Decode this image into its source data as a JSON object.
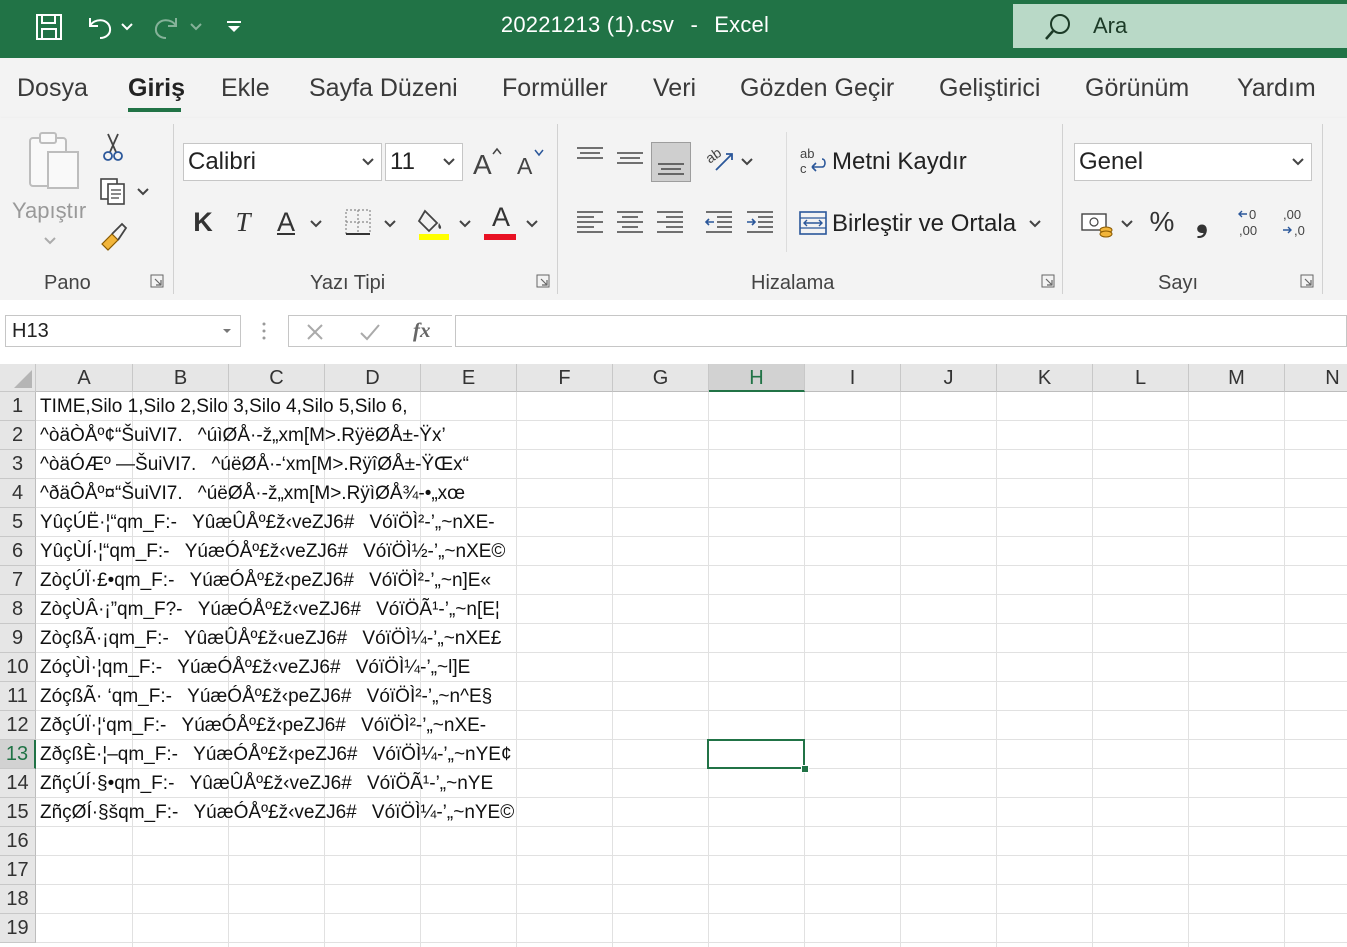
{
  "window": {
    "file_name": "20221213 (1).csv",
    "separator": "-",
    "app_name": "Excel",
    "search_placeholder": "Ara"
  },
  "tabs": [
    "Dosya",
    "Giriş",
    "Ekle",
    "Sayfa Düzeni",
    "Formüller",
    "Veri",
    "Gözden Geçir",
    "Geliştirici",
    "Görünüm",
    "Yardım"
  ],
  "active_tab": "Giriş",
  "ribbon": {
    "clipboard": {
      "paste_label": "Yapıştır",
      "group_label": "Pano"
    },
    "font": {
      "font_name": "Calibri",
      "font_size": "11",
      "bold": "K",
      "italic": "T",
      "underline": "A",
      "font_color_glyph": "A",
      "group_label": "Yazı Tipi",
      "highlight_color": "#ffff00",
      "font_color": "#ff0000"
    },
    "alignment": {
      "wrap_text": "Metni Kaydır",
      "merge_center": "Birleştir ve Ortala",
      "group_label": "Hizalama"
    },
    "number": {
      "format": "Genel",
      "percent": "%",
      "comma": "❟",
      "group_label": "Sayı"
    }
  },
  "formula_bar": {
    "name_box": "H13",
    "formula": ""
  },
  "columns": [
    "A",
    "B",
    "C",
    "D",
    "E",
    "F",
    "G",
    "H",
    "I",
    "J",
    "K",
    "L",
    "M",
    "N"
  ],
  "selected_column": "H",
  "selected_row": "13",
  "rows": [
    "1",
    "2",
    "3",
    "4",
    "5",
    "6",
    "7",
    "8",
    "9",
    "10",
    "11",
    "12",
    "13",
    "14",
    "15",
    "16",
    "17",
    "18",
    "19"
  ],
  "cells_A": [
    "TIME,Silo 1,Silo 2,Silo 3,Silo 4,Silo 5,Silo 6,",
    "^òäÒÅº¢“ŠuiVI7.^úìØÅ·-ž„xm[M>.RÿëØÅ±-Ÿx’",
    "^òäÓÆº —ŠuiVI7.^úëØÅ·-‘xm[M>.RÿîØÅ±-ŸŒx“",
    "^ðäÔÅº¤“ŠuiVI7.^úëØÅ·-ž„xm[M>.RÿìØÅ¾-•„xœ",
    "YûçÚË·¦“qm_F:-YûæÛÅº£ž‹veZJ6#VóïÖÌ²-’„~nXE-",
    "YûçÙÍ·¦“qm_F:-YúæÓÅº£ž‹veZJ6#VóïÖÌ½-’„~nXE©",
    "ZòçÚÏ·£•qm_F:-YúæÓÅº£ž‹peZJ6#VóïÖÌ²-’„~n]E«",
    "ZòçÙÂ·¡”qm_F?-YúæÓÅº£ž‹veZJ6#VóïÖÃ¹-’„~n[E¦",
    "ZòçßÃ·¡qm_F:-YûæÛÅº£ž‹ueZJ6#VóïÖÌ¼-’„~nXE£",
    "ZóçÙÌ·¦qm_F:-YúæÓÅº£ž‹veZJ6#VóïÖÌ¼-’„~l]E",
    "ZóçßÃ· ‘qm_F:-YúæÓÅº£ž‹peZJ6#VóïÖÌ²-’„~n^E§",
    "ZðçÚÏ·¦‘qm_F:-YúæÓÅº£ž‹peZJ6#VóïÖÌ²-’„~nXE-",
    "ZðçßÈ·¦–qm_F:-YúæÓÅº£ž‹peZJ6#VóïÖÌ¼-’„~nYE¢",
    "ZñçÚÍ·§•qm_F:-YûæÛÅº£ž‹veZJ6#VóïÖÃ¹-’„~nYE",
    "ZñçØÍ·§šqm_F:-YúæÓÅº£ž‹veZJ6#VóïÖÌ¼-’„~nYE©"
  ]
}
